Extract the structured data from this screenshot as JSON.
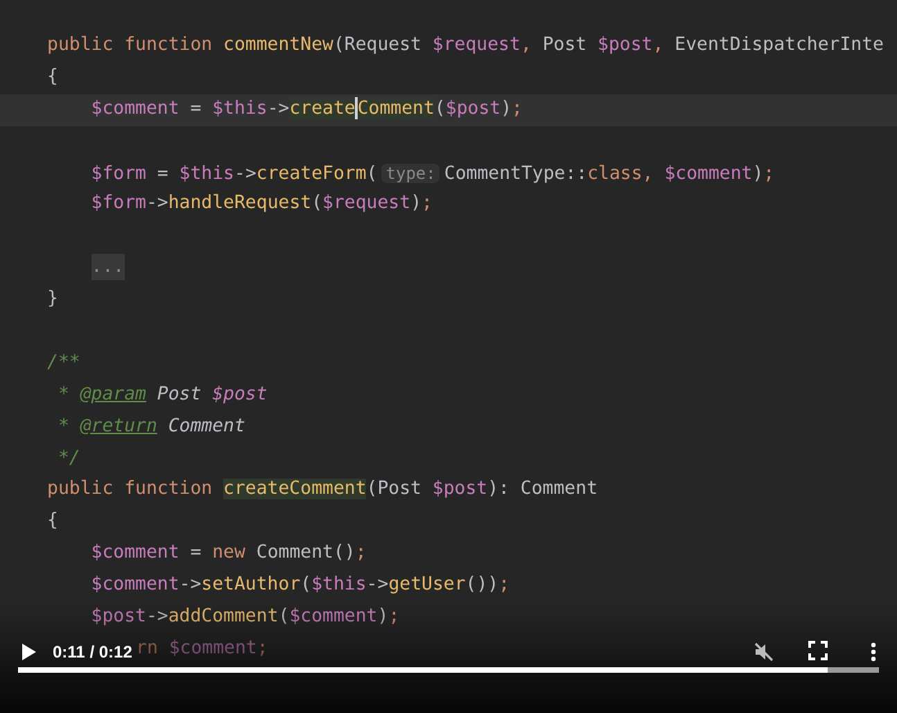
{
  "code": {
    "lines": [
      {
        "kind": "code",
        "current": false,
        "tokens": [
          {
            "t": "public function ",
            "kind": "kw"
          },
          {
            "t": "commentNew",
            "kind": "fn"
          },
          {
            "t": "(Request ",
            "kind": "plain"
          },
          {
            "t": "$request",
            "kind": "var"
          },
          {
            "t": ", ",
            "kind": "kw"
          },
          {
            "t": "Post ",
            "kind": "plain"
          },
          {
            "t": "$post",
            "kind": "var"
          },
          {
            "t": ", ",
            "kind": "kw"
          },
          {
            "t": "EventDispatcherInte",
            "kind": "plain"
          }
        ]
      },
      {
        "kind": "code",
        "current": false,
        "tokens": [
          {
            "t": "{",
            "kind": "plain"
          }
        ]
      },
      {
        "kind": "code",
        "current": true,
        "tokens": [
          {
            "t": "    $comment",
            "kind": "var"
          },
          {
            "t": " = ",
            "kind": "plain"
          },
          {
            "t": "$this",
            "kind": "var"
          },
          {
            "t": "->",
            "kind": "plain"
          },
          {
            "t": "create",
            "kind": "match"
          },
          {
            "kind": "caret"
          },
          {
            "t": "Comment",
            "kind": "match"
          },
          {
            "t": "(",
            "kind": "plain"
          },
          {
            "t": "$post",
            "kind": "var"
          },
          {
            "t": ")",
            "kind": "plain"
          },
          {
            "t": ";",
            "kind": "kw"
          }
        ]
      },
      {
        "kind": "blank"
      },
      {
        "kind": "code",
        "current": false,
        "tokens": [
          {
            "t": "    $form",
            "kind": "var"
          },
          {
            "t": " = ",
            "kind": "plain"
          },
          {
            "t": "$this",
            "kind": "var"
          },
          {
            "t": "->",
            "kind": "plain"
          },
          {
            "t": "createForm",
            "kind": "fn"
          },
          {
            "t": "(",
            "kind": "plain"
          },
          {
            "t": "type:",
            "kind": "hint"
          },
          {
            "t": "CommentType::",
            "kind": "plain"
          },
          {
            "t": "class",
            "kind": "kw"
          },
          {
            "t": ", ",
            "kind": "kw"
          },
          {
            "t": "$comment",
            "kind": "var"
          },
          {
            "t": ")",
            "kind": "plain"
          },
          {
            "t": ";",
            "kind": "kw"
          }
        ]
      },
      {
        "kind": "code",
        "current": false,
        "tokens": [
          {
            "t": "    $form",
            "kind": "var"
          },
          {
            "t": "->",
            "kind": "plain"
          },
          {
            "t": "handleRequest",
            "kind": "fn"
          },
          {
            "t": "(",
            "kind": "plain"
          },
          {
            "t": "$request",
            "kind": "var"
          },
          {
            "t": ")",
            "kind": "plain"
          },
          {
            "t": ";",
            "kind": "kw"
          }
        ]
      },
      {
        "kind": "blank"
      },
      {
        "kind": "code",
        "current": false,
        "tokens": [
          {
            "t": "...",
            "kind": "fold"
          }
        ]
      },
      {
        "kind": "code",
        "current": false,
        "tokens": [
          {
            "t": "}",
            "kind": "plain"
          }
        ]
      },
      {
        "kind": "blank"
      },
      {
        "kind": "code",
        "current": false,
        "tokens": [
          {
            "t": "/**",
            "kind": "doc"
          }
        ]
      },
      {
        "kind": "code",
        "current": false,
        "tokens": [
          {
            "t": " * ",
            "kind": "doc"
          },
          {
            "t": "@param",
            "kind": "doctag"
          },
          {
            "t": " Post ",
            "kind": "doctext"
          },
          {
            "t": "$post",
            "kind": "docvar"
          }
        ]
      },
      {
        "kind": "code",
        "current": false,
        "tokens": [
          {
            "t": " * ",
            "kind": "doc"
          },
          {
            "t": "@return",
            "kind": "doctag"
          },
          {
            "t": " Comment",
            "kind": "doctext"
          }
        ]
      },
      {
        "kind": "code",
        "current": false,
        "tokens": [
          {
            "t": " */",
            "kind": "doc"
          }
        ]
      },
      {
        "kind": "code",
        "current": false,
        "tokens": [
          {
            "t": "public function ",
            "kind": "kw"
          },
          {
            "t": "createComment",
            "kind": "match"
          },
          {
            "t": "(Post ",
            "kind": "plain"
          },
          {
            "t": "$post",
            "kind": "var"
          },
          {
            "t": "): Comment",
            "kind": "plain"
          }
        ]
      },
      {
        "kind": "code",
        "current": false,
        "tokens": [
          {
            "t": "{",
            "kind": "plain"
          }
        ]
      },
      {
        "kind": "code",
        "current": false,
        "tokens": [
          {
            "t": "    $comment",
            "kind": "var"
          },
          {
            "t": " = ",
            "kind": "plain"
          },
          {
            "t": "new ",
            "kind": "kw"
          },
          {
            "t": "Comment()",
            "kind": "plain"
          },
          {
            "t": ";",
            "kind": "kw"
          }
        ]
      },
      {
        "kind": "code",
        "current": false,
        "tokens": [
          {
            "t": "    $comment",
            "kind": "var"
          },
          {
            "t": "->",
            "kind": "plain"
          },
          {
            "t": "setAuthor",
            "kind": "fn"
          },
          {
            "t": "(",
            "kind": "plain"
          },
          {
            "t": "$this",
            "kind": "var"
          },
          {
            "t": "->",
            "kind": "plain"
          },
          {
            "t": "getUser",
            "kind": "fn"
          },
          {
            "t": "())",
            "kind": "plain"
          },
          {
            "t": ";",
            "kind": "kw"
          }
        ]
      },
      {
        "kind": "code",
        "current": false,
        "tokens": [
          {
            "t": "    $post",
            "kind": "var"
          },
          {
            "t": "->",
            "kind": "plain"
          },
          {
            "t": "addComment",
            "kind": "fn"
          },
          {
            "t": "(",
            "kind": "plain"
          },
          {
            "t": "$comment",
            "kind": "var"
          },
          {
            "t": ")",
            "kind": "plain"
          },
          {
            "t": ";",
            "kind": "kw"
          }
        ]
      },
      {
        "kind": "covered",
        "tokens": [
          {
            "t": "rn ",
            "kind": "kw"
          },
          {
            "t": "$comment",
            "kind": "var"
          },
          {
            "t": ";",
            "kind": "kw"
          }
        ]
      }
    ]
  },
  "player": {
    "playing": false,
    "time": "0:11 / 0:12",
    "muted": true,
    "progress": {
      "level": 0.94
    }
  }
}
